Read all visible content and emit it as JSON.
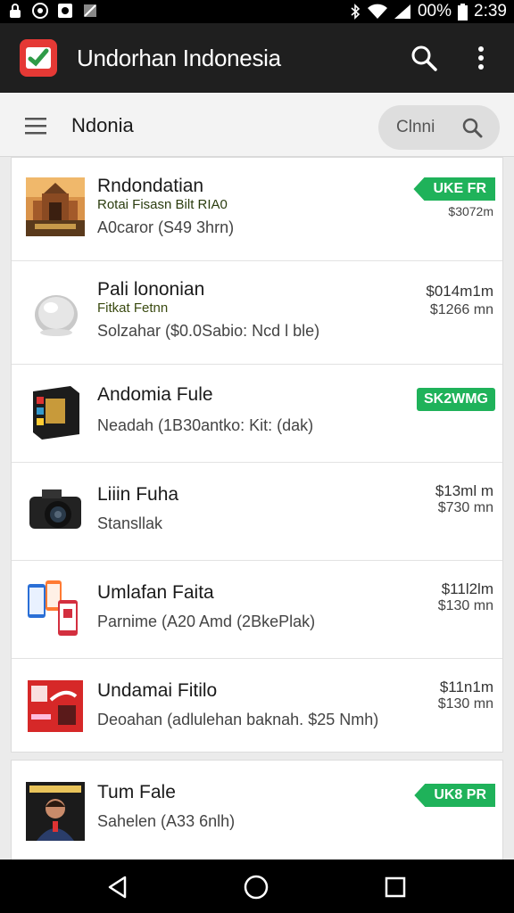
{
  "status_bar": {
    "battery_text": "00%",
    "time": "2:39",
    "left_icons": [
      "lock-icon",
      "camera-icon",
      "photo-icon",
      "image-icon"
    ],
    "right_icons": [
      "bluetooth-icon",
      "wifi-icon",
      "signal-icon",
      "battery-icon"
    ]
  },
  "app_bar": {
    "title": "Undorhan Indonesia",
    "icons": [
      "app-logo-icon",
      "search-icon",
      "more-vert-icon"
    ]
  },
  "sub_bar": {
    "title": "Ndonia",
    "search_placeholder": "Clnni",
    "icons": [
      "menu-icon",
      "search-icon"
    ]
  },
  "items": [
    {
      "title": "Rndondatian",
      "subtitle": "Rotai Fisasn Bilt RIA0",
      "description": "A0caror (S49 3hrn)",
      "badge": "UKE FR",
      "price2": "$3072m",
      "thumb": "temple-thumbnail"
    },
    {
      "title": "Pali lononian",
      "subtitle": "Fitkat Fetnn",
      "description": "Solzahar ($0.0Sabio: Ncd l ble)",
      "price1": "$014m1m",
      "price2": "$1266 mn",
      "thumb": "lens-thumbnail"
    },
    {
      "title": "Andomia Fule",
      "subtitle": "",
      "description": "Neadah (1B30antko: Kit: (dak)",
      "badge": "SK2WMG",
      "thumb": "box-thumbnail"
    },
    {
      "title": "Liiin Fuha",
      "subtitle": "",
      "description": "Stansllak",
      "price1": "$13ml m",
      "price2": "$730 mn",
      "thumb": "camera-thumbnail"
    },
    {
      "title": "Umlafan Faita",
      "subtitle": "",
      "description": "Parnime (A20 Amd (2BkePlak)",
      "price1": "$11l2lm",
      "price2": "$130 mn",
      "thumb": "phones-thumbnail"
    },
    {
      "title": "Undamai Fitilo",
      "subtitle": "",
      "description": "Deoahan (adlulehan baknah. $25 Nmh)",
      "price1": "$11n1m",
      "price2": "$130 mn",
      "thumb": "red-box-thumbnail"
    },
    {
      "title": "Tum Fale",
      "subtitle": "",
      "description": "Sahelen (A33 6nlh)",
      "badge": "UK8 PR",
      "thumb": "person-thumbnail"
    }
  ],
  "nav_bar": {
    "icons": [
      "back-icon",
      "home-icon",
      "recents-icon"
    ]
  },
  "colors": {
    "app_bar": "#1f1f1f",
    "sub_bar": "#f3f3f3",
    "badge_green": "#1fb25a",
    "logo_red": "#e53935"
  }
}
